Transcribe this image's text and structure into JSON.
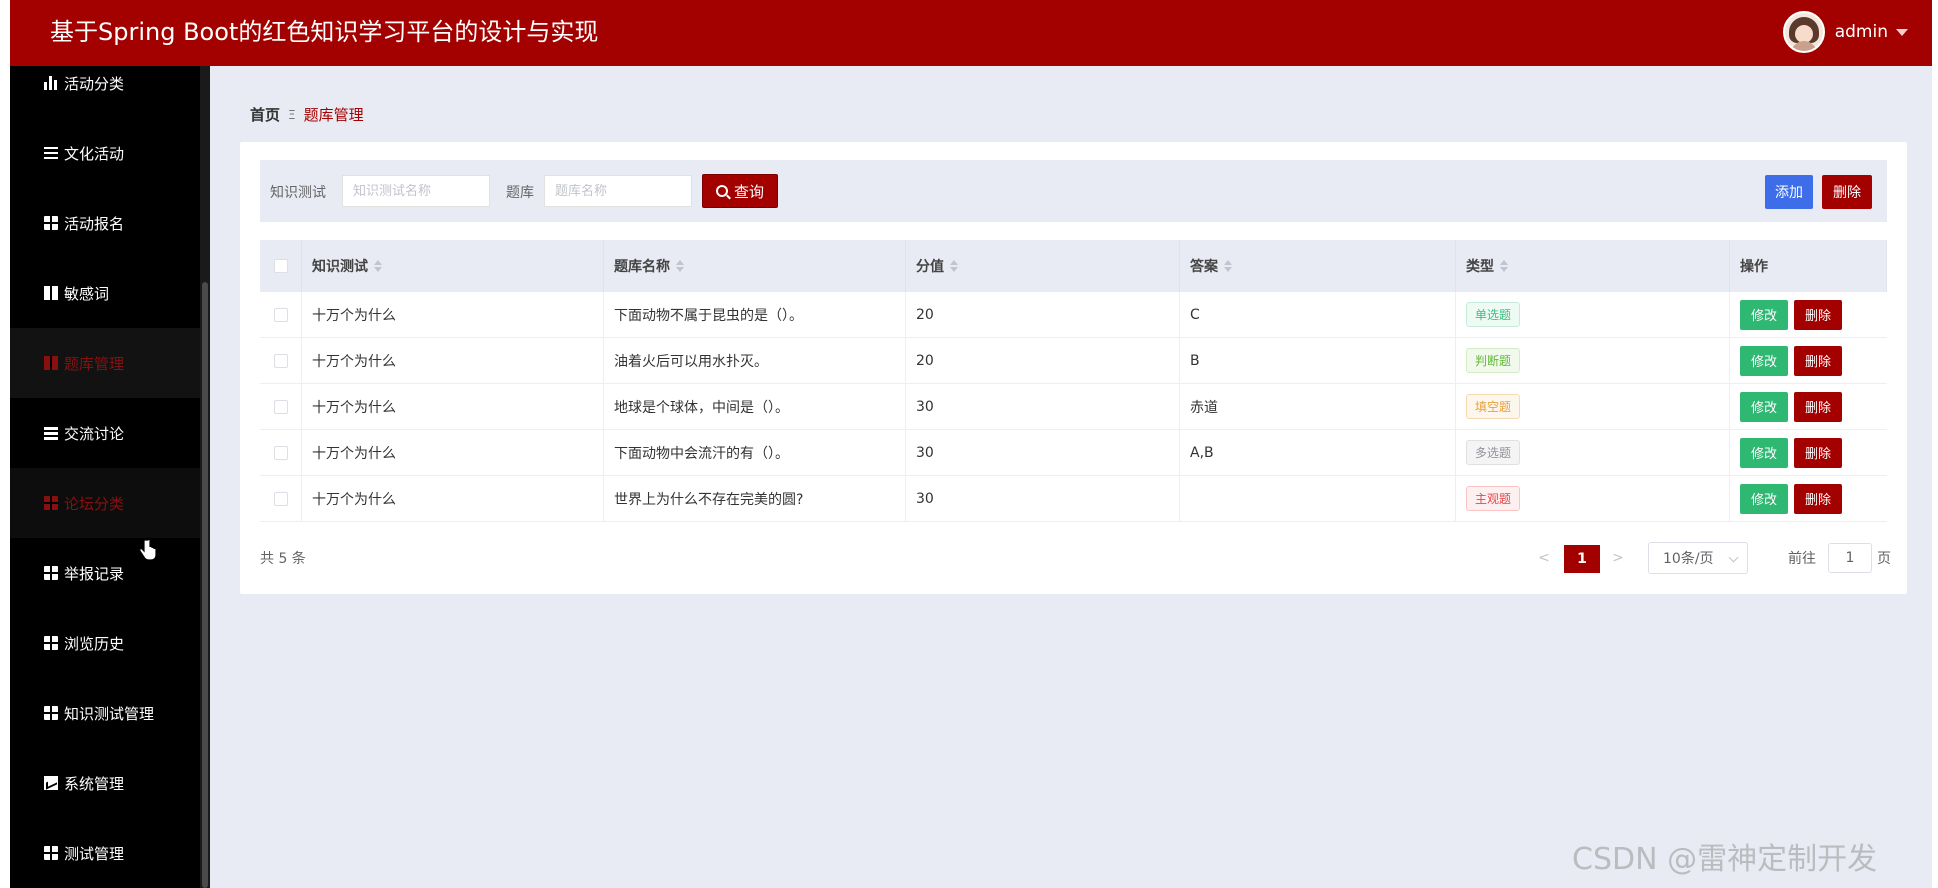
{
  "header": {
    "title": "基于Spring Boot的红色知识学习平台的设计与实现",
    "user": "admin"
  },
  "sidebar": {
    "items": [
      {
        "label": "活动分类",
        "icon": "bar-chart-icon"
      },
      {
        "label": "文化活动",
        "icon": "sliders-icon"
      },
      {
        "label": "活动报名",
        "icon": "grid-icon"
      },
      {
        "label": "敏感词",
        "icon": "book-icon"
      },
      {
        "label": "题库管理",
        "icon": "bookmark-icon"
      },
      {
        "label": "交流讨论",
        "icon": "list-icon"
      },
      {
        "label": "论坛分类",
        "icon": "grid-icon"
      },
      {
        "label": "举报记录",
        "icon": "grid-icon"
      },
      {
        "label": "浏览历史",
        "icon": "grid-icon"
      },
      {
        "label": "知识测试管理",
        "icon": "grid-icon"
      },
      {
        "label": "系统管理",
        "icon": "chart-icon"
      },
      {
        "label": "测试管理",
        "icon": "grid-icon"
      }
    ]
  },
  "breadcrumb": {
    "home": "首页",
    "separator": "Ξ",
    "current": "题库管理"
  },
  "search": {
    "test_label": "知识测试",
    "test_placeholder": "知识测试名称",
    "bank_label": "题库",
    "bank_placeholder": "题库名称",
    "query_label": "查询",
    "add_label": "添加",
    "delete_label": "删除"
  },
  "table": {
    "columns": [
      "知识测试",
      "题库名称",
      "分值",
      "答案",
      "类型",
      "操作"
    ],
    "rows": [
      {
        "test": "十万个为什么",
        "name": "下面动物不属于昆虫的是（）。",
        "score": "20",
        "answer": "C",
        "type": "单选题"
      },
      {
        "test": "十万个为什么",
        "name": "油着火后可以用水扑灭。",
        "score": "20",
        "answer": "B",
        "type": "判断题"
      },
      {
        "test": "十万个为什么",
        "name": "地球是个球体，中间是（）。",
        "score": "30",
        "answer": "赤道",
        "type": "填空题"
      },
      {
        "test": "十万个为什么",
        "name": "下面动物中会流汗的有（）。",
        "score": "30",
        "answer": "A,B",
        "type": "多选题"
      },
      {
        "test": "十万个为什么",
        "name": "世界上为什么不存在完美的圆?",
        "score": "30",
        "answer": "",
        "type": "主观题"
      }
    ],
    "edit_label": "修改",
    "delete_label": "删除"
  },
  "pagination": {
    "total": "共 5 条",
    "prev": "<",
    "current_page": "1",
    "next": ">",
    "page_size": "10条/页",
    "goto_label": "前往",
    "goto_value": "1",
    "goto_unit": "页"
  },
  "watermark": "CSDN @雷神定制开发",
  "colors": {
    "brand": "#a30000",
    "add_button": "#3d6de8",
    "edit_button": "#2eb872"
  }
}
